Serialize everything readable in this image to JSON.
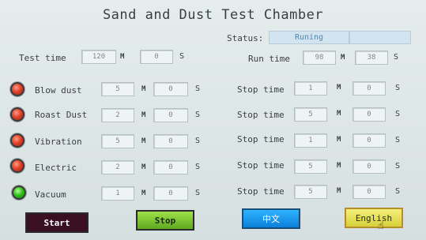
{
  "title": "Sand and Dust Test Chamber",
  "status": {
    "label": "Status:",
    "value": "Runing"
  },
  "test_time": {
    "label": "Test time",
    "min": "120",
    "min_unit": "M",
    "sec": "0",
    "sec_unit": "S"
  },
  "run_time": {
    "label": "Run time",
    "min": "98",
    "min_unit": "M",
    "sec": "38",
    "sec_unit": "S"
  },
  "rows": [
    {
      "lamp": "red",
      "name": "Blow dust",
      "min": "5",
      "min_unit": "M",
      "sec": "0",
      "sec_unit": "S",
      "stop_label": "Stop time",
      "stop_min": "1",
      "stop_min_unit": "M",
      "stop_sec": "0",
      "stop_sec_unit": "S"
    },
    {
      "lamp": "red",
      "name": "Roast Dust",
      "min": "2",
      "min_unit": "M",
      "sec": "0",
      "sec_unit": "S",
      "stop_label": "Stop time",
      "stop_min": "5",
      "stop_min_unit": "M",
      "stop_sec": "0",
      "stop_sec_unit": "S"
    },
    {
      "lamp": "red",
      "name": "Vibration",
      "min": "5",
      "min_unit": "M",
      "sec": "0",
      "sec_unit": "S",
      "stop_label": "Stop time",
      "stop_min": "1",
      "stop_min_unit": "M",
      "stop_sec": "0",
      "stop_sec_unit": "S"
    },
    {
      "lamp": "red",
      "name": "Electric",
      "min": "2",
      "min_unit": "M",
      "sec": "0",
      "sec_unit": "S",
      "stop_label": "Stop time",
      "stop_min": "5",
      "stop_min_unit": "M",
      "stop_sec": "0",
      "stop_sec_unit": "S"
    },
    {
      "lamp": "green",
      "name": "Vacuum",
      "min": "1",
      "min_unit": "M",
      "sec": "0",
      "sec_unit": "S",
      "stop_label": "Stop time",
      "stop_min": "5",
      "stop_min_unit": "M",
      "stop_sec": "0",
      "stop_sec_unit": "S"
    }
  ],
  "buttons": {
    "start": "Start",
    "stop": "Stop",
    "chinese": "中文",
    "english": "English"
  },
  "colors": {
    "lamp_red": "#e0442c",
    "lamp_green": "#34c21c",
    "status_text": "#4a88b6",
    "start_bg": "#3a0f22",
    "stop_bg": "#7cc83a",
    "chinese_bg": "#1d9be9",
    "english_bg": "#e6df55"
  },
  "icons": {
    "cursor": "hand-pointer-icon"
  }
}
